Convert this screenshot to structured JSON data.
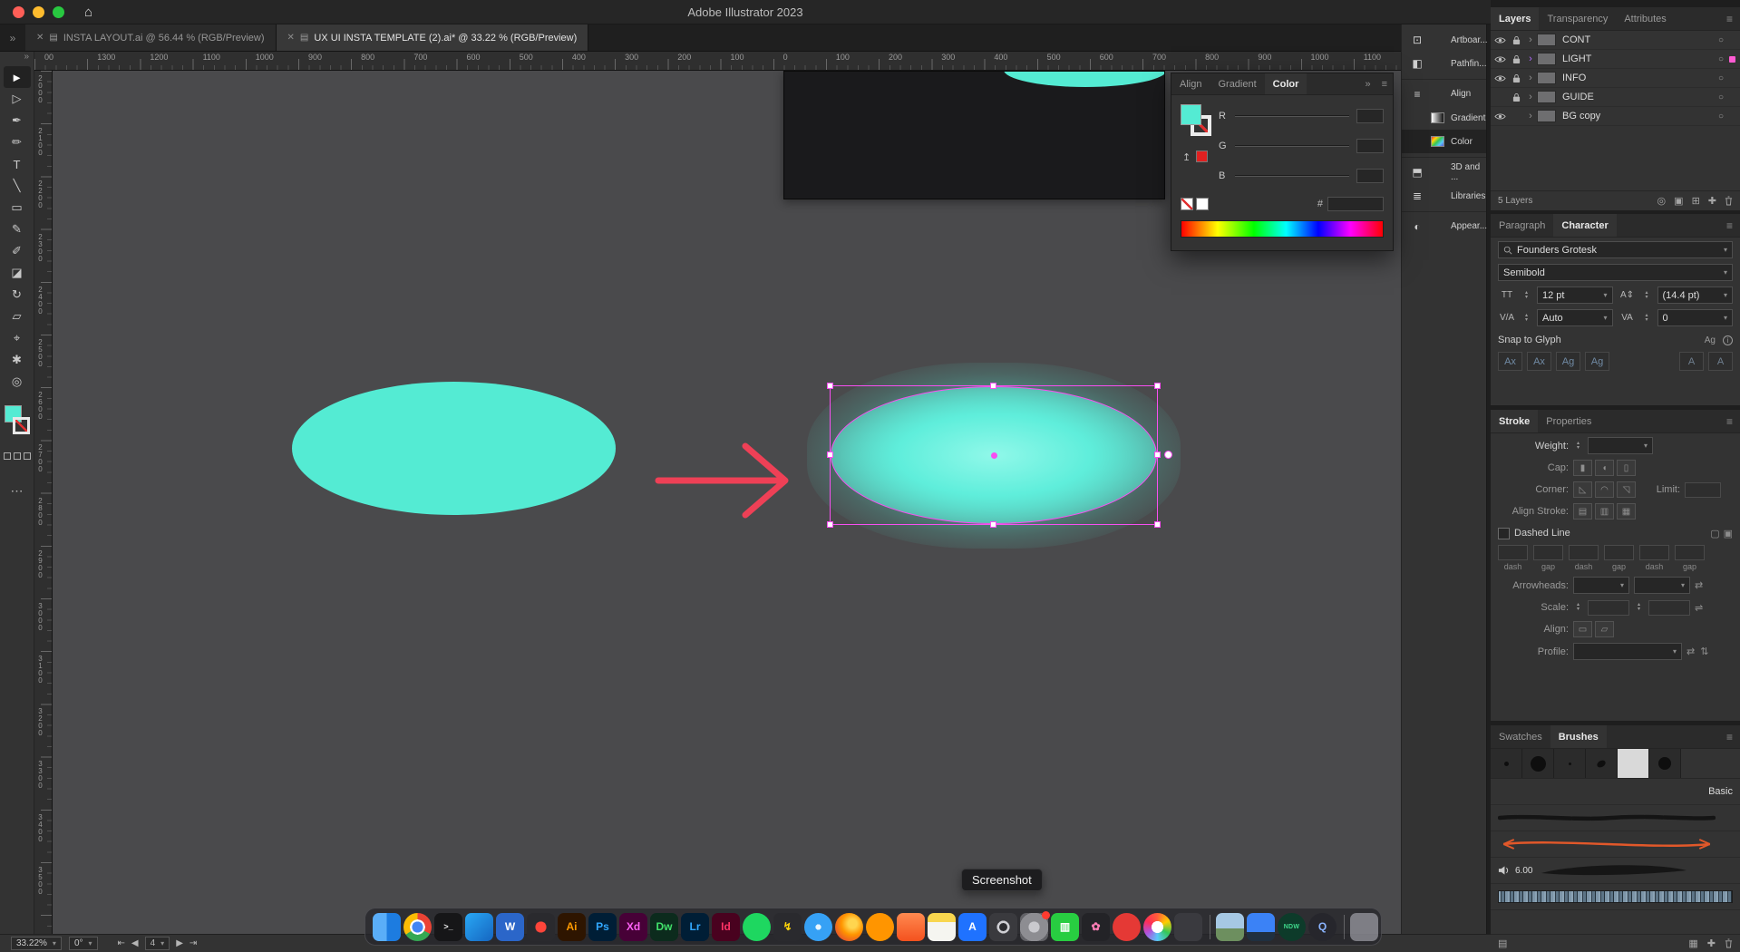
{
  "colors": {
    "teal": "#54ebd3",
    "magenta": "#f84ff1",
    "arrow_red": "#ee4056",
    "panel_bg": "#323232",
    "canvas_bg": "#4a4a4c"
  },
  "titlebar": {
    "title": "Adobe Illustrator 2023",
    "home_icon": "⌂"
  },
  "ui": {
    "chevrons": "»",
    "menu": "≡",
    "disclosure": "›",
    "target": "○",
    "doc_icon": "▤",
    "close": "✕",
    "scroll_up": "▲",
    "nav_first": "⇤",
    "nav_prev": "◀",
    "nav_next": "▶",
    "nav_last": "⇥"
  },
  "tabs": [
    {
      "label": "INSTA LAYOUT.ai @ 56.44 % (RGB/Preview)",
      "active": false
    },
    {
      "label": "UX UI INSTA TEMPLATE (2).ai* @ 33.22 % (RGB/Preview)",
      "active": true
    }
  ],
  "rulers": {
    "horizontal": [
      "00",
      "1300",
      "1200",
      "1100",
      "1000",
      "900",
      "800",
      "700",
      "600",
      "500",
      "400",
      "300",
      "200",
      "100",
      "0",
      "100",
      "200",
      "300",
      "400",
      "500",
      "600",
      "700",
      "800",
      "900",
      "1000",
      "1100"
    ],
    "vertical": [
      "2000",
      "2100",
      "2200",
      "2300",
      "2400",
      "2500",
      "2600",
      "2700",
      "2800",
      "2900",
      "3000",
      "3100",
      "3200",
      "3300",
      "3400",
      "3500"
    ]
  },
  "toolbar": {
    "more": "⋯",
    "tools": [
      {
        "name": "selection-tool",
        "glyph": "►",
        "active": true
      },
      {
        "name": "direct-selection-tool",
        "glyph": "▷"
      },
      {
        "name": "pen-tool",
        "glyph": "✒"
      },
      {
        "name": "curvature-tool",
        "glyph": "✏"
      },
      {
        "name": "type-tool",
        "glyph": "T"
      },
      {
        "name": "line-segment-tool",
        "glyph": "╲"
      },
      {
        "name": "rectangle-tool",
        "glyph": "▭"
      },
      {
        "name": "paintbrush-tool",
        "glyph": "✎"
      },
      {
        "name": "pencil-tool",
        "glyph": "✐"
      },
      {
        "name": "eraser-tool",
        "glyph": "◪"
      },
      {
        "name": "rotate-tool",
        "glyph": "↻"
      },
      {
        "name": "scale-tool",
        "glyph": "▱"
      },
      {
        "name": "eyedropper-tool",
        "glyph": "⌖"
      },
      {
        "name": "hand-tool",
        "glyph": "✱"
      },
      {
        "name": "zoom-tool",
        "glyph": "◎"
      }
    ]
  },
  "color_panel": {
    "tabs": [
      "Align",
      "Gradient",
      "Color"
    ],
    "active_tab": "Color",
    "channels": [
      "R",
      "G",
      "B"
    ],
    "hex_label": "#",
    "collapse_icon": "»",
    "menu_icon": "≡",
    "last_color_arrow": "↥"
  },
  "panel_dock": {
    "items": [
      {
        "name": "artboards",
        "label": "Artboar...",
        "glyph": "⊡"
      },
      {
        "name": "pathfinder",
        "label": "Pathfin...",
        "glyph": "◧"
      },
      {
        "name": "align",
        "label": "Align",
        "glyph": "≡",
        "group": true
      },
      {
        "name": "gradient",
        "label": "Gradient",
        "swatch": "linear-gradient(90deg,#ffffff,#111111)"
      },
      {
        "name": "color",
        "label": "Color",
        "swatch": "linear-gradient(135deg,#ff3b30,#ffd60a,#34c759,#5ac8fa,#5856d6)",
        "active": true
      },
      {
        "name": "3d-and-materials",
        "label": "3D and ...",
        "glyph": "⬒",
        "group": true
      },
      {
        "name": "libraries",
        "label": "Libraries",
        "glyph": "≣"
      },
      {
        "name": "appearance",
        "label": "Appear...",
        "glyph": "◐",
        "group": true
      }
    ]
  },
  "layers": {
    "tabs": [
      "Layers",
      "Transparency",
      "Attributes"
    ],
    "active_tab": "Layers",
    "rows": [
      {
        "name": "CONT",
        "eye": true,
        "lock": true
      },
      {
        "name": "LIGHT",
        "eye": true,
        "lock": true,
        "accent": "#b06cff",
        "dot": "#ff5bd3"
      },
      {
        "name": "INFO",
        "eye": true,
        "lock": true
      },
      {
        "name": "GUIDE",
        "eye": false,
        "lock": true
      },
      {
        "name": "BG copy",
        "eye": true,
        "lock": false
      }
    ],
    "status": "5 Layers",
    "footer_icons": [
      "◎",
      "▣",
      "⊞",
      "✚"
    ]
  },
  "character": {
    "tabs": [
      "Paragraph",
      "Character"
    ],
    "active_tab": "Character",
    "font_family": "Founders Grotesk",
    "font_style": "Semibold",
    "size_icon": "TT",
    "size_value": "12 pt",
    "leading_icon": "A⇕",
    "leading_value": "(14.4 pt)",
    "kerning_icon": "V/A",
    "kerning_value": "Auto",
    "tracking_icon": "VA",
    "tracking_value": "0",
    "snap_heading": "Snap to Glyph",
    "snap_icon": "Ag",
    "info_icon": "i",
    "glyph_buttons": [
      "Ax",
      "Ax",
      "Ag",
      "Ag"
    ],
    "glyph_buttons_right": [
      "A",
      "A"
    ]
  },
  "stroke": {
    "tabs": [
      "Stroke",
      "Properties"
    ],
    "active_tab": "Stroke",
    "weight_label": "Weight:",
    "cap_label": "Cap:",
    "corner_label": "Corner:",
    "limit_label": "Limit:",
    "align_stroke_label": "Align Stroke:",
    "dashed_label": "Dashed Line",
    "dash_cells": [
      "dash",
      "gap",
      "dash",
      "gap",
      "dash",
      "gap"
    ],
    "arrowheads_label": "Arrowheads:",
    "scale_label": "Scale:",
    "align_label": "Align:",
    "profile_label": "Profile:",
    "cap_icons": [
      "▮",
      "◖",
      "▯"
    ],
    "corner_icons": [
      "◺",
      "◠",
      "◹"
    ],
    "align_stroke_icons": [
      "▤",
      "▥",
      "▦"
    ],
    "dashed_corner_icons": [
      "▢",
      "▣"
    ],
    "align_icons": [
      "▭",
      "▱"
    ],
    "swap_icon": "⇄",
    "link_icon": "⇌",
    "profile_flip_icons": [
      "⇄",
      "⇅"
    ]
  },
  "brushes": {
    "tabs": [
      "Swatches",
      "Brushes"
    ],
    "active_tab": "Brushes",
    "thumbs": [
      {
        "dot": "1"
      },
      {
        "dot": "2"
      },
      {
        "dot": "3"
      },
      {
        "dot": "4"
      },
      {
        "dot": "5"
      },
      {
        "dot": "6"
      }
    ],
    "basic_label": "Basic",
    "taper_value": "6.00",
    "footer_icons": [
      "▤",
      "▦",
      "✚"
    ]
  },
  "statusbar": {
    "zoom": "33.22%",
    "rotation": "0°",
    "artboard": "4"
  },
  "dock": {
    "tooltip": "Screenshot",
    "items": [
      {
        "name": "finder",
        "label": "",
        "bg": "linear-gradient(90deg,#5aaef8 0 50%,#1d7ce0 50%)"
      },
      {
        "name": "chrome",
        "circle": true,
        "label": "",
        "bg": "radial-gradient(circle,#4285f4 0 28%,#ffffff 28% 38%,transparent 38%),conic-gradient(#ea4335 0 33%,#34a853 33% 66%,#fbbc05 66%)"
      },
      {
        "name": "terminal",
        "label": ">_",
        "bg": "#161618",
        "fg": "#e8e8e8"
      },
      {
        "name": "vscode",
        "label": "",
        "bg": "linear-gradient(135deg,#29a8f5,#1565c0)"
      },
      {
        "name": "word",
        "label": "W",
        "bg": "#2b66c9",
        "fg": "#ffffff"
      },
      {
        "name": "media-app",
        "label": "",
        "bg": "radial-gradient(circle,#ff453a 0 28%,#2a2a2e 28%)"
      },
      {
        "name": "illustrator",
        "label": "Ai",
        "bg": "#2e1500",
        "fg": "#ff9a00"
      },
      {
        "name": "photoshop",
        "label": "Ps",
        "bg": "#001e36",
        "fg": "#31a8ff"
      },
      {
        "name": "adobe-xd",
        "label": "Xd",
        "bg": "#470137",
        "fg": "#ff61f6"
      },
      {
        "name": "dreamweaver",
        "label": "Dw",
        "bg": "#0c2b1d",
        "fg": "#41e06a"
      },
      {
        "name": "lightroom",
        "label": "Lr",
        "bg": "#001e36",
        "fg": "#31a8ff"
      },
      {
        "name": "indesign",
        "label": "Id",
        "bg": "#49021f",
        "fg": "#ff3366"
      },
      {
        "name": "spotify",
        "circle": true,
        "label": "",
        "bg": "#1ed760"
      },
      {
        "name": "automator-bolt",
        "label": "↯",
        "bg": "#2a2a2e",
        "fg": "#ffd60a"
      },
      {
        "name": "safari",
        "circle": true,
        "label": "",
        "bg": "radial-gradient(circle,#e8f6ff 0 14%,#36a1f5 14%)"
      },
      {
        "name": "firefox",
        "circle": true,
        "label": "",
        "bg": "radial-gradient(circle at 62% 38%,#ffd54f 0 18%,#ff9500 45%,#e8552a 78%)"
      },
      {
        "name": "orange-app",
        "circle": true,
        "label": "",
        "bg": "#ff9500"
      },
      {
        "name": "mail-orange",
        "label": "",
        "bg": "linear-gradient(180deg,#ff8a50,#f4511e)"
      },
      {
        "name": "notes",
        "label": "",
        "bg": "linear-gradient(180deg,#f8d64e 0 32%,#f5f5f0 32%)"
      },
      {
        "name": "appstore",
        "label": "A",
        "bg": "#1f72ff",
        "fg": "#ffffff"
      },
      {
        "name": "screenshot",
        "label": "",
        "bg": "radial-gradient(circle,#2c2c30 0 20%,#cfcfd4 20% 32%,#3a3a3e 32%)"
      },
      {
        "name": "system-settings",
        "badge": true,
        "label": "",
        "bg": "radial-gradient(circle,#c9c9ce 0 28%,#8d8d92 28% 72%,#626267 72%)"
      },
      {
        "name": "numbers",
        "label": "▥",
        "bg": "#28cd41",
        "fg": "#ffffff"
      },
      {
        "name": "photos-dark",
        "label": "✿",
        "bg": "#232327",
        "fg": "#ff7eb6"
      },
      {
        "name": "red-media-app",
        "circle": true,
        "label": "",
        "bg": "#e53935"
      },
      {
        "name": "photos",
        "circle": true,
        "label": "",
        "bg": "radial-gradient(circle,#ffffff 0 30%,transparent 30%),conic-gradient(#ff5e3a,#ffcc00,#34c759,#5ac8fa,#af52de,#ff2d55,#ff5e3a)"
      },
      {
        "name": "utility-dark",
        "label": "",
        "bg": "#3a3a3f"
      },
      {
        "name": "image-preview",
        "divider": true,
        "label": "",
        "bg": "linear-gradient(180deg,#a6c8e4 0 55%,#6d8f5f 55%)"
      },
      {
        "name": "display-sidecar",
        "label": "",
        "bg": "linear-gradient(180deg,#3b82f6 0 68%,#203040 68%)"
      },
      {
        "name": "ndw-app",
        "circle": true,
        "label": "NDW",
        "bg": "#0d3b2a",
        "fg": "#3fd98c"
      },
      {
        "name": "quicktime",
        "circle": true,
        "label": "Q",
        "bg": "#26262c",
        "fg": "#8ab4ff"
      },
      {
        "name": "trash",
        "divider": true,
        "label": "",
        "bg": "rgba(206,206,216,0.5)"
      }
    ]
  }
}
